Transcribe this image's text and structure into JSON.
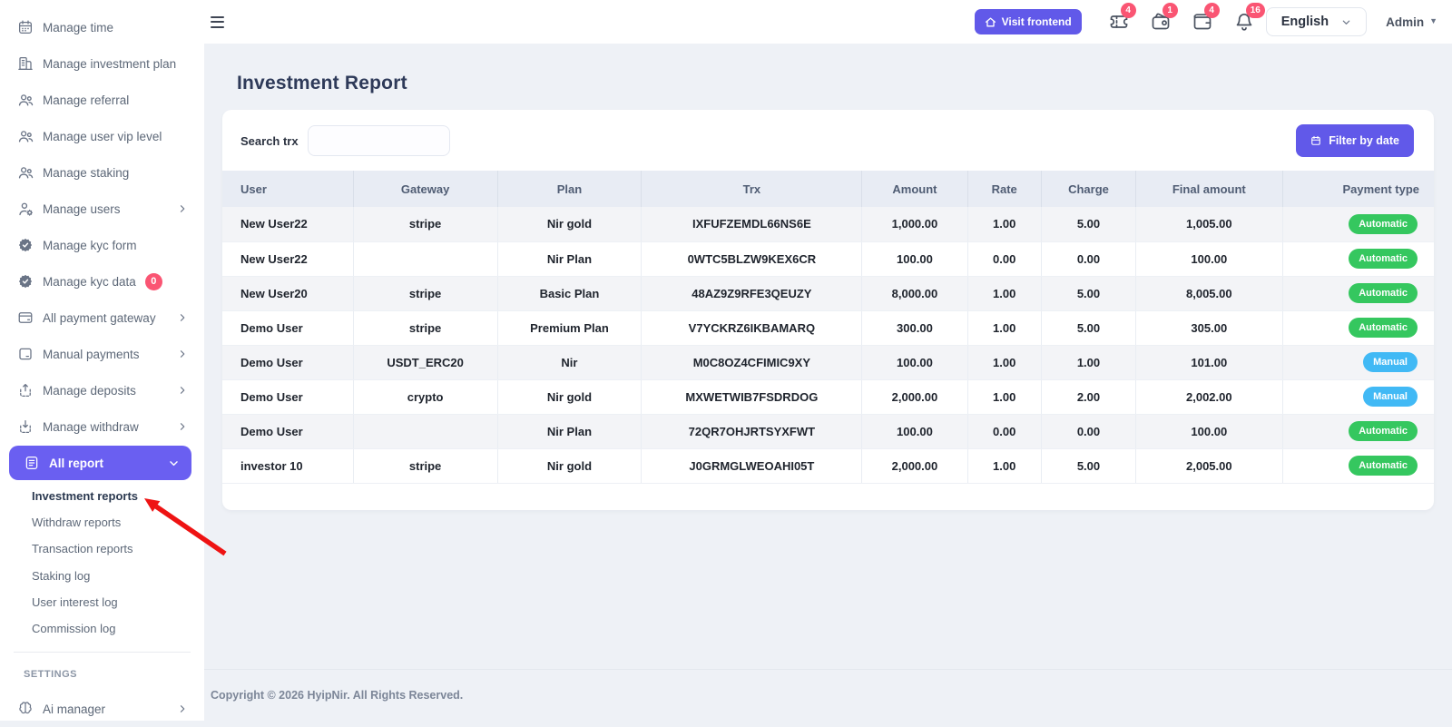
{
  "topbar": {
    "visit_frontend_label": "Visit frontend",
    "language": "English",
    "user_menu": "Admin",
    "icons": [
      {
        "name": "ticket",
        "badge": "4"
      },
      {
        "name": "wallet-coin",
        "badge": "1"
      },
      {
        "name": "wallet",
        "badge": "4"
      },
      {
        "name": "bell",
        "badge": "16"
      }
    ]
  },
  "sidebar": {
    "items": [
      {
        "label": "Manage time",
        "icon": "calendar"
      },
      {
        "label": "Manage investment plan",
        "icon": "building"
      },
      {
        "label": "Manage referral",
        "icon": "users"
      },
      {
        "label": "Manage user vip level",
        "icon": "users"
      },
      {
        "label": "Manage staking",
        "icon": "users"
      },
      {
        "label": "Manage users",
        "icon": "user-gear",
        "chevron": true
      },
      {
        "label": "Manage kyc form",
        "icon": "badge-check"
      },
      {
        "label": "Manage kyc data",
        "icon": "badge-check",
        "badge": "0"
      },
      {
        "label": "All payment gateway",
        "icon": "credit-card",
        "chevron": true
      },
      {
        "label": "Manual payments",
        "icon": "card",
        "chevron": true
      },
      {
        "label": "Manage deposits",
        "icon": "deposit",
        "chevron": true
      },
      {
        "label": "Manage withdraw",
        "icon": "withdraw",
        "chevron": true
      },
      {
        "label": "All report",
        "icon": "report",
        "active": true,
        "expanded": true
      }
    ],
    "report_submenu": [
      "Investment reports",
      "Withdraw reports",
      "Transaction reports",
      "Staking log",
      "User interest log",
      "Commission log"
    ],
    "active_submenu": "Investment reports",
    "settings_header": "SETTINGS",
    "settings_items": [
      {
        "label": "Ai manager",
        "icon": "brain",
        "chevron": true
      }
    ]
  },
  "main": {
    "title": "Investment Report",
    "search_label": "Search trx",
    "search_value": "",
    "filter_button_label": "Filter by date",
    "table": {
      "columns": [
        "User",
        "Gateway",
        "Plan",
        "Trx",
        "Amount",
        "Rate",
        "Charge",
        "Final amount",
        "Payment type"
      ],
      "rows": [
        {
          "user": "New User22",
          "gateway": "stripe",
          "plan": "Nir gold",
          "trx": "IXFUFZEMDL66NS6E",
          "amount": "1,000.00",
          "rate": "1.00",
          "charge": "5.00",
          "final_amount": "1,005.00",
          "payment_type": "Automatic"
        },
        {
          "user": "New User22",
          "gateway": "",
          "plan": "Nir Plan",
          "trx": "0WTC5BLZW9KEX6CR",
          "amount": "100.00",
          "rate": "0.00",
          "charge": "0.00",
          "final_amount": "100.00",
          "payment_type": "Automatic"
        },
        {
          "user": "New User20",
          "gateway": "stripe",
          "plan": "Basic Plan",
          "trx": "48AZ9Z9RFE3QEUZY",
          "amount": "8,000.00",
          "rate": "1.00",
          "charge": "5.00",
          "final_amount": "8,005.00",
          "payment_type": "Automatic"
        },
        {
          "user": "Demo User",
          "gateway": "stripe",
          "plan": "Premium Plan",
          "trx": "V7YCKRZ6IKBAMARQ",
          "amount": "300.00",
          "rate": "1.00",
          "charge": "5.00",
          "final_amount": "305.00",
          "payment_type": "Automatic"
        },
        {
          "user": "Demo User",
          "gateway": "USDT_ERC20",
          "plan": "Nir",
          "trx": "M0C8OZ4CFIMIC9XY",
          "amount": "100.00",
          "rate": "1.00",
          "charge": "1.00",
          "final_amount": "101.00",
          "payment_type": "Manual"
        },
        {
          "user": "Demo User",
          "gateway": "crypto",
          "plan": "Nir gold",
          "trx": "MXWETWIB7FSDRDOG",
          "amount": "2,000.00",
          "rate": "1.00",
          "charge": "2.00",
          "final_amount": "2,002.00",
          "payment_type": "Manual"
        },
        {
          "user": "Demo User",
          "gateway": "",
          "plan": "Nir Plan",
          "trx": "72QR7OHJRTSYXFWT",
          "amount": "100.00",
          "rate": "0.00",
          "charge": "0.00",
          "final_amount": "100.00",
          "payment_type": "Automatic"
        },
        {
          "user": "investor 10",
          "gateway": "stripe",
          "plan": "Nir gold",
          "trx": "J0GRMGLWEOAHI05T",
          "amount": "2,000.00",
          "rate": "1.00",
          "charge": "5.00",
          "final_amount": "2,005.00",
          "payment_type": "Automatic"
        }
      ]
    }
  },
  "footer": {
    "copyright": "Copyright © 2026 HyipNir. All Rights Reserved."
  },
  "colors": {
    "accent_purple": "#6159e9",
    "active_sidebar": "#6a5ff1",
    "badge_red": "#fa5573",
    "automatic_green": "#35c75f",
    "manual_blue": "#41b9f5",
    "title_navy": "#2e3a59",
    "annotation_red": "#ee1313"
  }
}
